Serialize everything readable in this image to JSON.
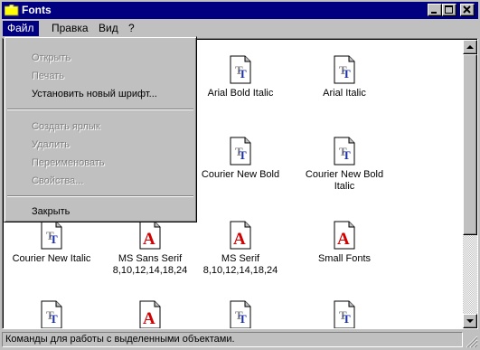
{
  "window": {
    "title": "Fonts"
  },
  "menubar": {
    "file": "Файл",
    "edit": "Правка",
    "view": "Вид",
    "help": "?"
  },
  "file_menu": {
    "open": "Открыть",
    "print": "Печать",
    "install": "Установить новый шрифт...",
    "create_shortcut": "Создать ярлык",
    "delete": "Удалить",
    "rename": "Переименовать",
    "properties": "Свойства...",
    "close": "Закрыть"
  },
  "fonts": [
    {
      "label": "Arial Bold Italic",
      "icon": "truetype-font-icon"
    },
    {
      "label": "Arial Italic",
      "icon": "truetype-font-icon"
    },
    {
      "label": "Courier New Bold",
      "icon": "truetype-font-icon"
    },
    {
      "label": "Courier New Bold\nItalic",
      "icon": "truetype-font-icon"
    },
    {
      "label": "Courier New Italic",
      "icon": "truetype-font-icon"
    },
    {
      "label": "MS Sans Serif\n8,10,12,14,18,24",
      "icon": "raster-font-icon"
    },
    {
      "label": "MS Serif\n8,10,12,14,18,24",
      "icon": "raster-font-icon"
    },
    {
      "label": "Small Fonts",
      "icon": "raster-font-icon"
    },
    {
      "label": "",
      "icon": "truetype-font-icon"
    },
    {
      "label": "",
      "icon": "raster-font-icon"
    },
    {
      "label": "",
      "icon": "truetype-font-icon"
    },
    {
      "label": "",
      "icon": "truetype-font-icon"
    }
  ],
  "statusbar": {
    "text": "Команды для работы с выделенными объектами."
  },
  "colors": {
    "title_bar": "#000080",
    "window_face": "#c0c0c0",
    "truetype_blue": "#1a2fa8",
    "raster_red": "#d00000"
  }
}
